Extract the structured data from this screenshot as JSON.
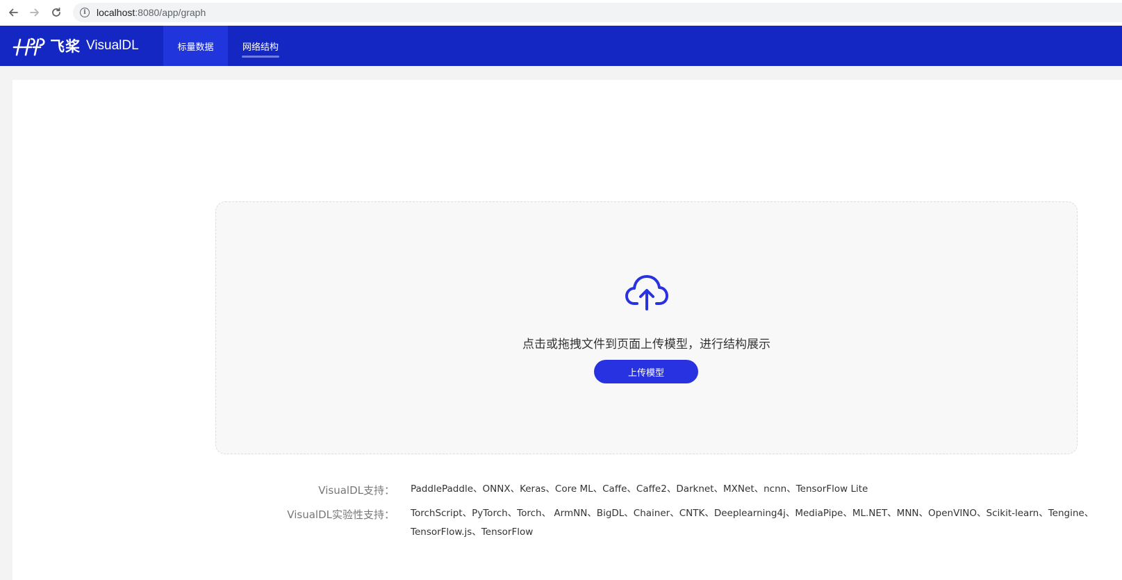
{
  "browser": {
    "url_host": "localhost",
    "url_port_path": ":8080/app/graph",
    "back_icon": "arrow-left-icon",
    "forward_icon": "arrow-right-icon",
    "reload_icon": "reload-icon",
    "info_icon": "info-icon"
  },
  "header": {
    "logo_cn": "飞桨",
    "logo_text": "VisualDL",
    "tabs": [
      {
        "label": "标量数据",
        "active": false
      },
      {
        "label": "网络结构",
        "active": true
      }
    ],
    "colors": {
      "header_bg": "#1527c2",
      "active_tab_bg": "#2135dc"
    }
  },
  "upload": {
    "icon": "cloud-upload-icon",
    "hint": "点击或拖拽文件到页面上传模型，进行结构展示",
    "button_label": "上传模型",
    "colors": {
      "accent": "#2932e1"
    }
  },
  "support": {
    "label_supported": "VisualDL支持：",
    "value_supported": "PaddlePaddle、ONNX、Keras、Core ML、Caffe、Caffe2、Darknet、MXNet、ncnn、TensorFlow Lite",
    "label_experimental": "VisualDL实验性支持：",
    "value_experimental_line1": "TorchScript、PyTorch、Torch、 ArmNN、BigDL、Chainer、CNTK、Deeplearning4j、MediaPipe、ML.NET、MNN、OpenVINO、Scikit-learn、Tengine、",
    "value_experimental_line2": "TensorFlow.js、TensorFlow"
  }
}
